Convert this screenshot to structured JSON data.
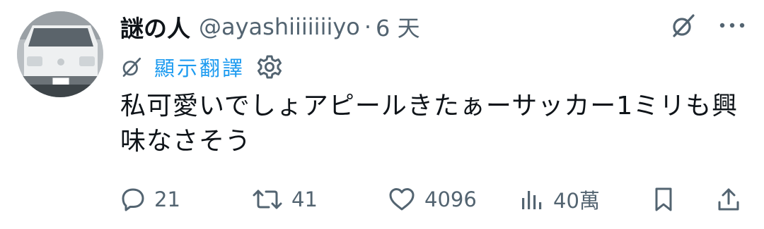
{
  "tweet": {
    "author": {
      "display_name": "謎の人",
      "handle": "@ayashiiiiiiiyo",
      "avatar_icon": "avatar-photo-van"
    },
    "separator": "·",
    "time_ago": "6 天",
    "translate": {
      "label": "顯示翻譯",
      "icon": "translate-icon",
      "settings_icon": "gear-icon"
    },
    "text": "私可愛いでしょアピールきたぁーサッカー1ミリも興味なさそう",
    "top_right": {
      "grok_icon": "grok-icon",
      "more_icon": "more-icon"
    },
    "actions": {
      "replies": "21",
      "retweets": "41",
      "likes": "4096",
      "views": "40萬"
    },
    "colors": {
      "accent": "#1d9bf0",
      "text": "#0f1419",
      "secondary": "#536471"
    }
  }
}
